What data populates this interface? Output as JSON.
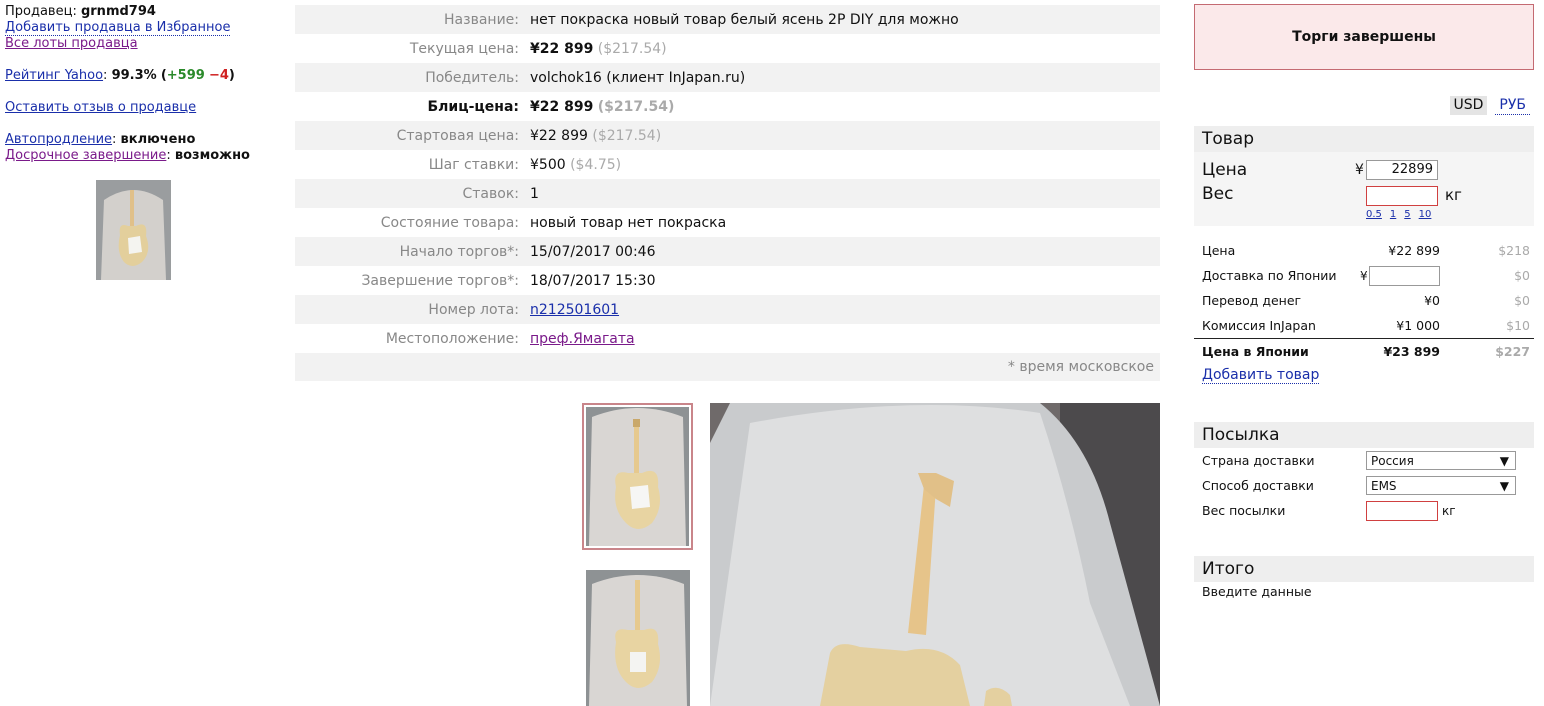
{
  "seller": {
    "label": "Продавец:",
    "name": "grnmd794",
    "add_favorite": "Добавить продавца в Избранное",
    "all_lots": "Все лоты продавца",
    "rating_label": "Рейтинг Yahoo",
    "rating_value": "99.3%",
    "rating_pos": "+599",
    "rating_neg": "−4",
    "feedback": "Оставить отзыв о продавце",
    "autoextend_label": "Автопродление",
    "autoextend_value": "включено",
    "early_end_label": "Досрочное завершение",
    "early_end_value": "возможно"
  },
  "info": {
    "rows": [
      {
        "label": "Название:",
        "value": "нет покраска новый товар белый ясень 2P DIY для можно"
      },
      {
        "label": "Текущая цена:",
        "yen": "¥22 899",
        "usd": "($217.54)"
      },
      {
        "label": "Победитель:",
        "value": "volchok16 (клиент InJapan.ru)"
      },
      {
        "label": "Блиц-цена:",
        "yen": "¥22 899",
        "usd": "($217.54)"
      },
      {
        "label": "Стартовая цена:",
        "yen": "¥22 899",
        "usd": "($217.54)"
      },
      {
        "label": "Шаг ставки:",
        "yen": "¥500",
        "usd": "($4.75)"
      },
      {
        "label": "Ставок:",
        "value": "1"
      },
      {
        "label": "Состояние товара:",
        "value": "новый товар нет покраска"
      },
      {
        "label": "Начало торгов*:",
        "value": "15/07/2017 00:46"
      },
      {
        "label": "Завершение торгов*:",
        "value": "18/07/2017 15:30"
      },
      {
        "label": "Номер лота:",
        "value": "n212501601"
      },
      {
        "label": "Местоположение:",
        "value": "преф.Ямагата"
      }
    ],
    "footnote": "* время московское"
  },
  "status": "Торги завершены",
  "currency": {
    "usd": "USD",
    "rub": "РУБ"
  },
  "product": {
    "title": "Товар",
    "price_label": "Цена",
    "yen_sign": "¥",
    "price_value": "22899",
    "weight_label": "Вес",
    "weight_unit": "кг",
    "weight_presets": [
      "0.5",
      "1",
      "5",
      "10"
    ]
  },
  "calc": {
    "rows": [
      {
        "label": "Цена",
        "yen": "¥22 899",
        "usd": "$218"
      },
      {
        "label": "Доставка по Японии",
        "yen": "",
        "usd": "$0"
      },
      {
        "label": "Перевод денег",
        "yen": "¥0",
        "usd": "$0"
      },
      {
        "label": "Комиссия InJapan",
        "yen": "¥1 000",
        "usd": "$10"
      }
    ],
    "total_label": "Цена в Японии",
    "total_yen": "¥23 899",
    "total_usd": "$227",
    "add_item": "Добавить товар"
  },
  "parcel": {
    "title": "Посылка",
    "country_label": "Страна доставки",
    "country_value": "Россия",
    "method_label": "Способ доставки",
    "method_value": "EMS",
    "weight_label": "Вес посылки",
    "weight_unit": "кг"
  },
  "total": {
    "title": "Итого",
    "message": "Введите данные"
  }
}
